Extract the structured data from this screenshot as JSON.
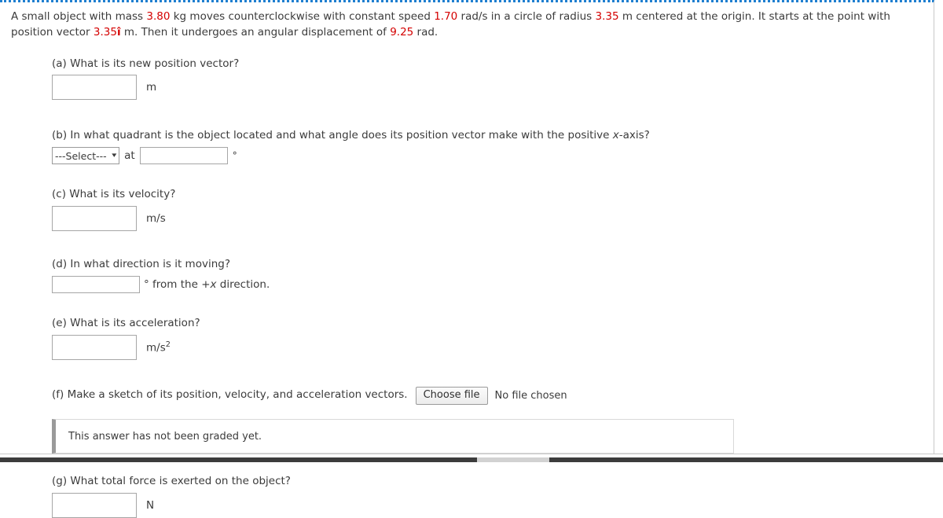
{
  "problem": {
    "line1_pre_mass": "A small object with mass ",
    "mass_value": "3.80",
    "line1_mid_1": " kg moves counterclockwise with constant speed ",
    "speed_value": "1.70",
    "line1_mid_2": " rad/s in a circle of radius ",
    "radius_value": "3.35",
    "line1_mid_3": " m centered at the origin. It starts at the point with position vector ",
    "position_value": "3.35",
    "position_unit_vector": "î",
    "line2_mid": " m. Then it undergoes an angular displacement of ",
    "displacement_value": "9.25",
    "line2_end": " rad."
  },
  "parts": {
    "a": {
      "label": "(a) What is its new position vector?",
      "input_value": "",
      "unit": "m"
    },
    "b": {
      "label_pre": "(b) In what quadrant is the object located and what angle does its position vector make with the positive ",
      "label_italic": "x",
      "label_post": "-axis?",
      "select_value": "---Select---",
      "select_caret": "⌄",
      "at_label": "at",
      "input_value": "",
      "degree_symbol": "°"
    },
    "c": {
      "label": "(c) What is its velocity?",
      "input_value": "",
      "unit": "m/s"
    },
    "d": {
      "label": "(d) In what direction is it moving?",
      "input_value": "",
      "unit_degree": "°",
      "unit_pre": " from the +",
      "unit_italic": "x",
      "unit_post": " direction."
    },
    "e": {
      "label": "(e) What is its acceleration?",
      "input_value": "",
      "unit_base": "m/s",
      "unit_exponent": "2"
    },
    "f": {
      "label": "(f) Make a sketch of its position, velocity, and acceleration vectors.",
      "choose_file_button": "Choose file",
      "no_file_text": "No file chosen",
      "graded_notice": "This answer has not been graded yet."
    },
    "g": {
      "label": "(g) What total force is exerted on the object?",
      "input_value": "",
      "unit": "N"
    }
  },
  "colors": {
    "value_red": "#d40000",
    "body_text": "#3b3b3b",
    "frame_blue": "#1f7fd0",
    "input_border": "#a6a6a6"
  }
}
